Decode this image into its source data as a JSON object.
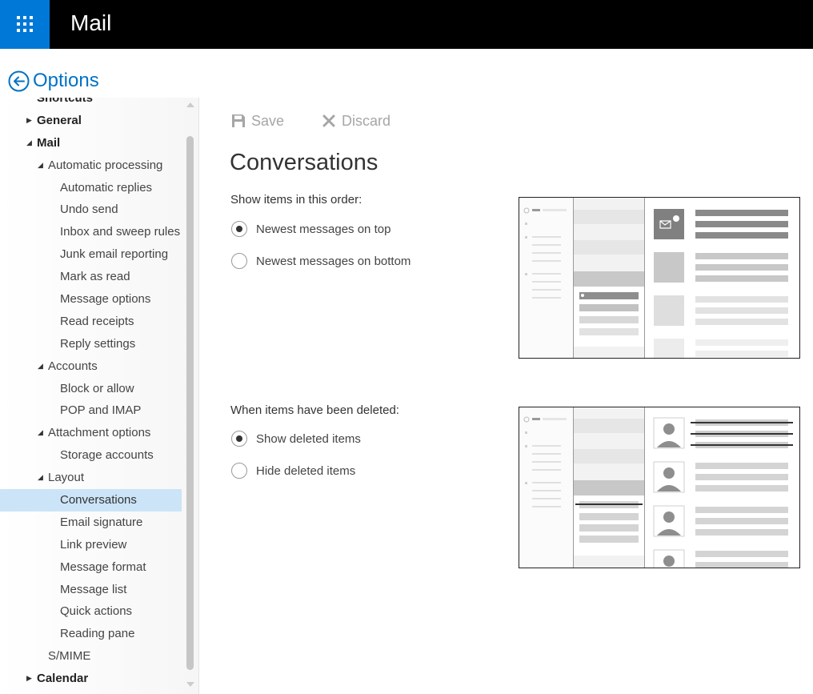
{
  "app": {
    "title": "Mail"
  },
  "options": {
    "title": "Options"
  },
  "nav": {
    "items": [
      {
        "label": "Shortcuts",
        "level": 1,
        "caret": "",
        "selected": false
      },
      {
        "label": "General",
        "level": 1,
        "caret": "collapsed",
        "selected": false
      },
      {
        "label": "Mail",
        "level": 1,
        "caret": "expanded",
        "selected": false
      },
      {
        "label": "Automatic processing",
        "level": 2,
        "caret": "expanded",
        "selected": false
      },
      {
        "label": "Automatic replies",
        "level": 3,
        "caret": "",
        "selected": false
      },
      {
        "label": "Undo send",
        "level": 3,
        "caret": "",
        "selected": false
      },
      {
        "label": "Inbox and sweep rules",
        "level": 3,
        "caret": "",
        "selected": false
      },
      {
        "label": "Junk email reporting",
        "level": 3,
        "caret": "",
        "selected": false
      },
      {
        "label": "Mark as read",
        "level": 3,
        "caret": "",
        "selected": false
      },
      {
        "label": "Message options",
        "level": 3,
        "caret": "",
        "selected": false
      },
      {
        "label": "Read receipts",
        "level": 3,
        "caret": "",
        "selected": false
      },
      {
        "label": "Reply settings",
        "level": 3,
        "caret": "",
        "selected": false
      },
      {
        "label": "Accounts",
        "level": 2,
        "caret": "expanded",
        "selected": false
      },
      {
        "label": "Block or allow",
        "level": 3,
        "caret": "",
        "selected": false
      },
      {
        "label": "POP and IMAP",
        "level": 3,
        "caret": "",
        "selected": false
      },
      {
        "label": "Attachment options",
        "level": 2,
        "caret": "expanded",
        "selected": false
      },
      {
        "label": "Storage accounts",
        "level": 3,
        "caret": "",
        "selected": false
      },
      {
        "label": "Layout",
        "level": 2,
        "caret": "expanded",
        "selected": false
      },
      {
        "label": "Conversations",
        "level": 3,
        "caret": "",
        "selected": true
      },
      {
        "label": "Email signature",
        "level": 3,
        "caret": "",
        "selected": false
      },
      {
        "label": "Link preview",
        "level": 3,
        "caret": "",
        "selected": false
      },
      {
        "label": "Message format",
        "level": 3,
        "caret": "",
        "selected": false
      },
      {
        "label": "Message list",
        "level": 3,
        "caret": "",
        "selected": false
      },
      {
        "label": "Quick actions",
        "level": 3,
        "caret": "",
        "selected": false
      },
      {
        "label": "Reading pane",
        "level": 3,
        "caret": "",
        "selected": false
      },
      {
        "label": "S/MIME",
        "level": 2,
        "caret": "",
        "selected": false
      },
      {
        "label": "Calendar",
        "level": 1,
        "caret": "collapsed",
        "selected": false
      }
    ]
  },
  "toolbar": {
    "save_label": "Save",
    "discard_label": "Discard"
  },
  "main": {
    "title": "Conversations",
    "order": {
      "label": "Show items in this order:",
      "options": [
        {
          "label": "Newest messages on top",
          "checked": true
        },
        {
          "label": "Newest messages on bottom",
          "checked": false
        }
      ]
    },
    "deleted": {
      "label": "When items have been deleted:",
      "options": [
        {
          "label": "Show deleted items",
          "checked": true
        },
        {
          "label": "Hide deleted items",
          "checked": false
        }
      ]
    }
  },
  "icons": {
    "waffle": "app-launcher-icon",
    "back": "back-arrow-icon",
    "save": "save-icon",
    "discard": "discard-icon",
    "expanded": "caret-expanded-icon",
    "collapsed": "caret-collapsed-icon"
  },
  "colors": {
    "accent": "#0078d7",
    "link": "#0072c6",
    "selection": "#cce4f7",
    "topbar": "#000000",
    "disabled": "#a6a6a6"
  }
}
